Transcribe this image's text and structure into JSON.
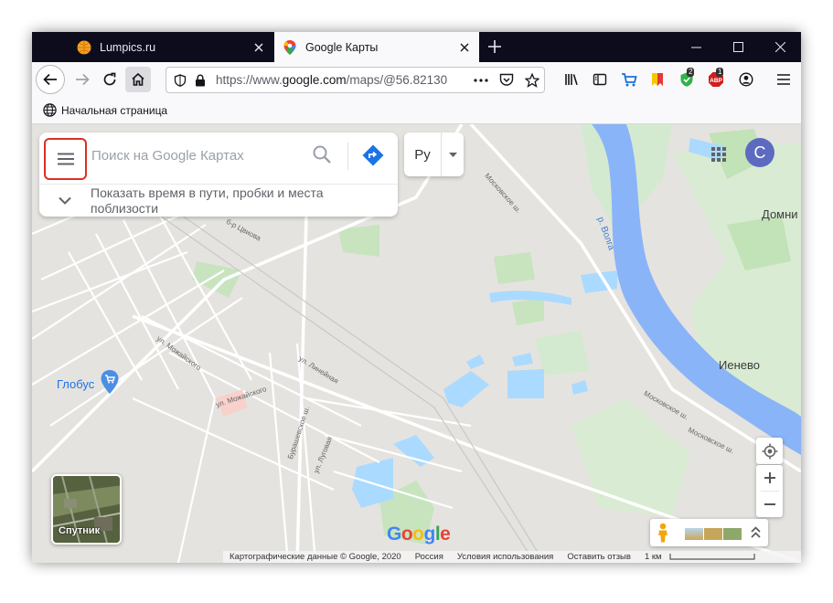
{
  "tabs": [
    {
      "title": "Lumpics.ru",
      "icon": "lumpics-favicon"
    },
    {
      "title": "Google Карты",
      "icon": "google-maps-favicon",
      "active": true
    }
  ],
  "nav": {
    "url_prefix": "https://www.",
    "url_host": "google.com",
    "url_path": "/maps/@56.82130",
    "badge_shield": "2",
    "badge_abp": "1"
  },
  "bookmarks": {
    "home_label": "Начальная страница"
  },
  "map": {
    "search_placeholder": "Поиск на Google Картах",
    "hint_text": "Показать время в пути, пробки и места поблизости",
    "lang_label": "Ру",
    "user_initial": "С",
    "satellite_label": "Спутник",
    "google_logo": "Google",
    "place_labels": {
      "globus": "Глобус",
      "domni": "Домни",
      "ienevo": "Иенево",
      "volga": "р. Волга"
    },
    "street_labels": {
      "moskovskoe_top": "Московское ш.",
      "moskovskoe_bottom": "Московское ш.",
      "moskovskoe_right": "Московское ш.",
      "tsvetova": "б-р Цвиова",
      "mozhaiskogo_1": "ул. Можайского",
      "mozhaiskogo_2": "ул. Можайского",
      "lineinaya": "ул. Линейная",
      "burashevskoe": "Бурашевское ш.",
      "lugovaya": "ул. Луговая"
    },
    "footer": {
      "map_data": "Картографические данные © Google, 2020",
      "region": "Россия",
      "terms": "Условия использования",
      "feedback": "Оставить отзыв",
      "scale": "1 км"
    }
  },
  "colors": {
    "tabbar_bg": "#0c0c1d",
    "toolbar_bg": "#f9f9fb",
    "map_bg": "#e5e3df",
    "water": "#aadaff",
    "river": "#8ab4f8",
    "park": "#c8e6b5",
    "highlight_red": "#d93025",
    "avatar": "#5c6bc0"
  }
}
